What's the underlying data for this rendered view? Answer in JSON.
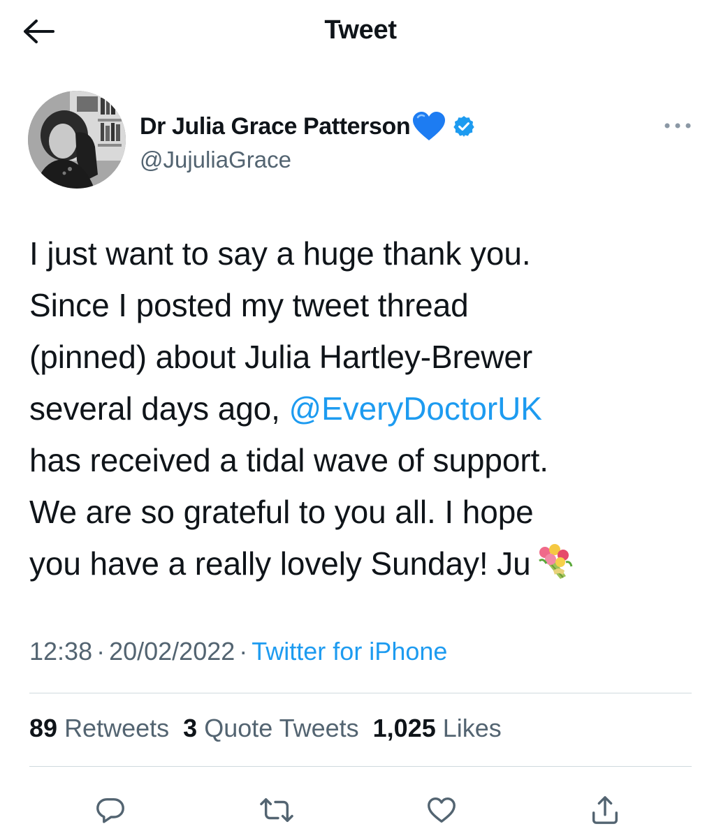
{
  "header": {
    "title": "Tweet",
    "back_icon": "arrow-left-icon"
  },
  "author": {
    "display_name": "Dr Julia Grace Patterson",
    "handle": "@JujuliaGrace",
    "heart_emoji": "blue-heart-icon",
    "verified_icon": "verified-badge-icon",
    "more_icon": "more-horizontal-icon"
  },
  "tweet": {
    "lines": [
      "I just want to say a huge thank you.",
      "Since I posted my tweet thread",
      "(pinned) about Julia Hartley-Brewer",
      "several days ago,",
      "has received a tidal wave of support.",
      "We are so grateful to you all. I hope",
      "you have a really lovely Sunday! Ju"
    ],
    "mention": "@EveryDoctorUK",
    "emoji": "bouquet-icon"
  },
  "meta": {
    "time": "12:38",
    "date": "20/02/2022",
    "separator": "·",
    "source": "Twitter for iPhone"
  },
  "stats": {
    "retweets_count": "89",
    "retweets_label": "Retweets",
    "quotes_count": "3",
    "quotes_label": "Quote Tweets",
    "likes_count": "1,025",
    "likes_label": "Likes"
  },
  "actions": [
    "reply-icon",
    "retweet-icon",
    "like-icon",
    "share-icon"
  ],
  "colors": {
    "accent": "#1d9bf0",
    "text": "#0f1419",
    "secondary": "#536471",
    "divider": "#cfd9de"
  }
}
